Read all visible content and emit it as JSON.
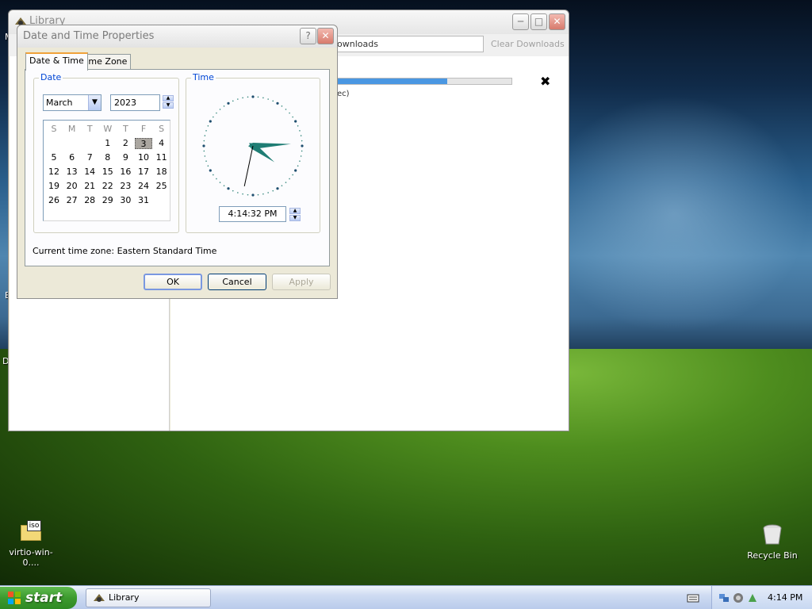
{
  "library_window": {
    "title": "Library",
    "search_text": "ownloads",
    "clear_button": "Clear Downloads",
    "download": {
      "progress_percent": 63,
      "status_fragment": "ec)"
    }
  },
  "dialog": {
    "title": "Date and Time Properties",
    "tabs": [
      {
        "label": "Date & Time",
        "active": true
      },
      {
        "label": "Time Zone",
        "active": false
      }
    ],
    "date_group_label": "Date",
    "time_group_label": "Time",
    "month": "March",
    "year": "2023",
    "weekday_headers": [
      "S",
      "M",
      "T",
      "W",
      "T",
      "F",
      "S"
    ],
    "calendar_weeks": [
      [
        "",
        "",
        "",
        "1",
        "2",
        "3",
        "4"
      ],
      [
        "5",
        "6",
        "7",
        "8",
        "9",
        "10",
        "11"
      ],
      [
        "12",
        "13",
        "14",
        "15",
        "16",
        "17",
        "18"
      ],
      [
        "19",
        "20",
        "21",
        "22",
        "23",
        "24",
        "25"
      ],
      [
        "26",
        "27",
        "28",
        "29",
        "30",
        "31",
        ""
      ]
    ],
    "selected_day": "3",
    "clock": {
      "hour": 4,
      "minute": 14,
      "second": 32
    },
    "time_value": "4:14:32 PM",
    "timezone_text": "Current time zone:  Eastern Standard Time",
    "buttons": {
      "ok": "OK",
      "cancel": "Cancel",
      "apply": "Apply"
    }
  },
  "desktop": {
    "iso_icon_badge": "iso",
    "iso_label": "virtio-win-0....",
    "recycle_label": "Recycle Bin",
    "edge_letters": [
      "M",
      "E",
      "D"
    ]
  },
  "taskbar": {
    "start_label": "start",
    "task_label": "Library",
    "clock": "4:14 PM"
  },
  "colors": {
    "clock_hands": "#1f7d74",
    "progress": "#4a97e2",
    "tab_highlight": "#f0a23a"
  }
}
